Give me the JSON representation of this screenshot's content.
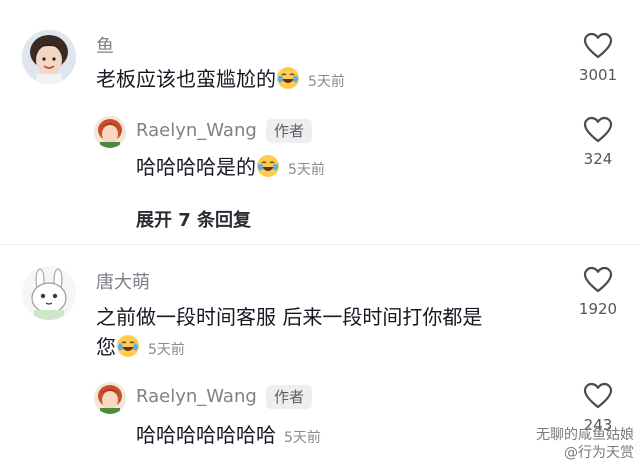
{
  "comments": [
    {
      "username": "鱼",
      "text": "老板应该也蛮尴尬的",
      "time": "5天前",
      "likes": "3001",
      "reply": {
        "username": "Raelyn_Wang",
        "author_tag": "作者",
        "text": "哈哈哈哈是的",
        "time": "5天前",
        "likes": "324"
      },
      "expand_label": "展开 7 条回复"
    },
    {
      "username": "唐大萌",
      "text_line1": "之前做一段时间客服 后来一段时间打你都是",
      "text_line2": "您",
      "time": "5天前",
      "likes": "1920",
      "reply": {
        "username": "Raelyn_Wang",
        "author_tag": "作者",
        "text": "哈哈哈哈哈哈哈",
        "time": "5天前",
        "likes": "243"
      }
    }
  ],
  "watermark": {
    "line1": "无聊的咸鱼姑娘",
    "line2": "@行为天赏"
  },
  "icons": {
    "like": "heart-outline-icon",
    "emoji": "laughing-tears-emoji"
  }
}
